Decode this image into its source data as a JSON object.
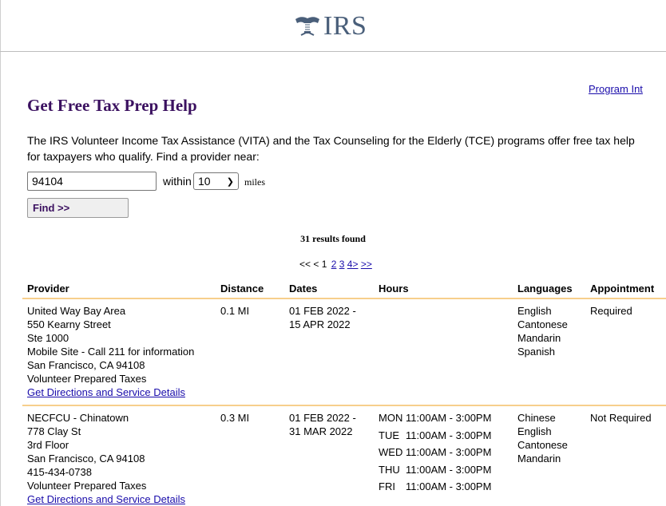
{
  "header": {
    "logo_text": "IRS",
    "logo_icon": "irs-eagle-emblem-icon"
  },
  "program_link": "Program Int",
  "page_title": "Get Free Tax Prep Help",
  "intro": {
    "line1": "The IRS Volunteer Income Tax Assistance (VITA) and the Tax Counseling for the Elderly (TCE) programs offer free tax help",
    "line2": "for taxpayers who qualify. Find a provider near:"
  },
  "search": {
    "zip_value": "94104",
    "within_label": "within",
    "radius_value": "10",
    "miles_label": "miles",
    "find_button": "Find >>"
  },
  "results_count": "31 results found",
  "pagination": {
    "prev": "<< < 1",
    "pages": [
      "2",
      "3",
      "4"
    ],
    "next_one": ">",
    "next_last": ">>"
  },
  "columns": [
    "Provider",
    "Distance",
    "Dates",
    "Hours",
    "Languages",
    "Appointment"
  ],
  "rows": [
    {
      "provider": [
        "United Way Bay Area",
        "550 Kearny Street",
        "Ste 1000",
        "Mobile Site - Call 211 for information",
        "San Francisco, CA 94108",
        "Volunteer Prepared Taxes"
      ],
      "link": "Get Directions and Service Details",
      "distance": "0.1 MI",
      "dates": [
        "01 FEB 2022 -",
        "15 APR 2022"
      ],
      "hours": [],
      "languages": [
        "English",
        "Cantonese",
        "Mandarin",
        "Spanish"
      ],
      "appointment": "Required"
    },
    {
      "provider": [
        "NECFCU - Chinatown",
        "778 Clay St",
        "3rd Floor",
        "San Francisco, CA 94108",
        "415-434-0738",
        "Volunteer Prepared Taxes"
      ],
      "link": "Get Directions and Service Details",
      "distance": "0.3 MI",
      "dates": [
        "01 FEB 2022 -",
        "31 MAR 2022"
      ],
      "hours": [
        {
          "day": "MON",
          "time": "11:00AM - 3:00PM"
        },
        {
          "day": "TUE",
          "time": "11:00AM - 3:00PM"
        },
        {
          "day": "WED",
          "time": "11:00AM - 3:00PM"
        },
        {
          "day": "THU",
          "time": "11:00AM - 3:00PM"
        },
        {
          "day": "FRI",
          "time": "11:00AM - 3:00PM"
        }
      ],
      "languages": [
        "Chinese",
        "English",
        "Cantonese",
        "Mandarin"
      ],
      "appointment": "Not Required"
    }
  ],
  "colors": {
    "title": "#3b1160",
    "link": "#1a0dab",
    "row_rule": "#f7cf8c",
    "logo": "#4a5f7a"
  }
}
